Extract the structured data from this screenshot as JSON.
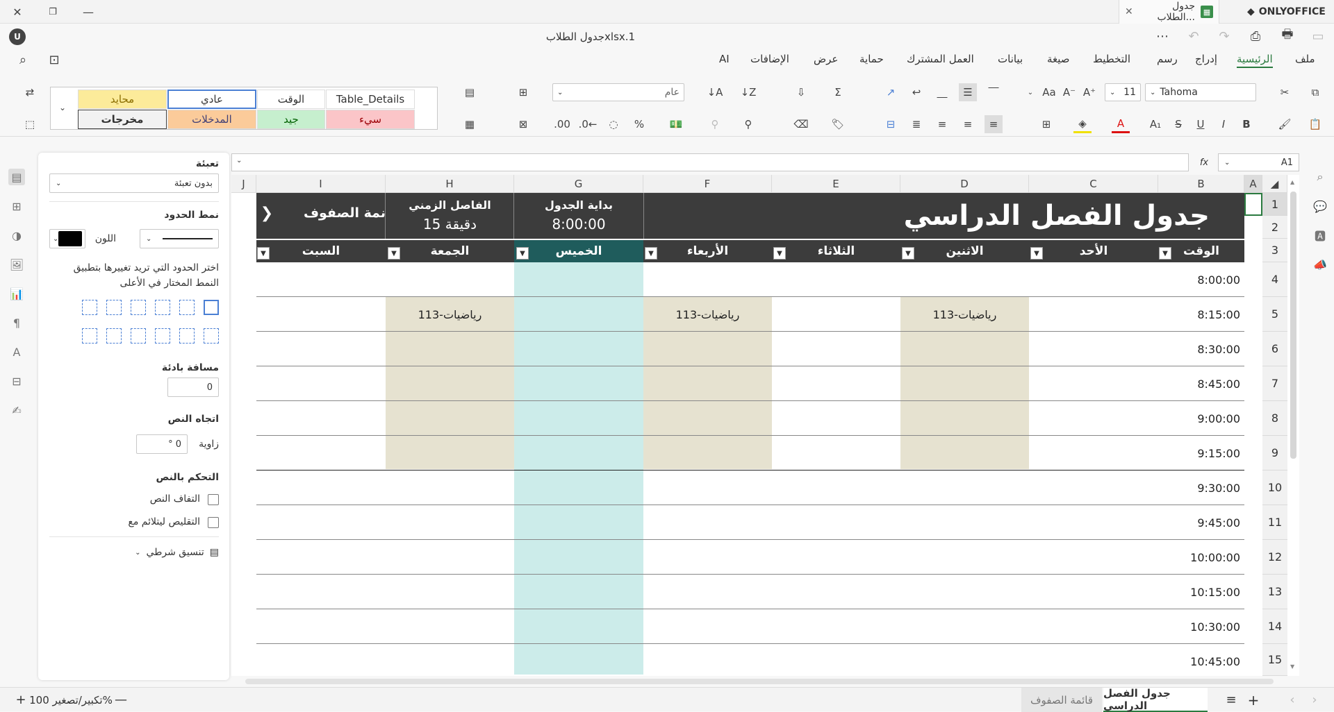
{
  "window": {
    "tab_title": "جدول الطلاب...",
    "brand": "ONLYOFFICE",
    "doc_title": "جدول الطلابxlsx.1",
    "user_initial": "U"
  },
  "menu": {
    "items": [
      "ملف",
      "الرئيسية",
      "إدراج",
      "رسم",
      "التخطيط",
      "صيغة",
      "بيانات",
      "العمل المشترك",
      "حماية",
      "عرض",
      "الإضافات",
      "AI"
    ],
    "active": "الرئيسية"
  },
  "toolbar": {
    "font_name": "Tahoma",
    "font_size": "11",
    "number_format": "عام",
    "styles": {
      "table_details": "Table_Details",
      "time": "الوقت",
      "normal": "عادي",
      "neutral": "محايد",
      "bad": "سيء",
      "good": "جيد",
      "input": "المدخلات",
      "output": "مخرجات"
    }
  },
  "formula_bar": {
    "cell_ref": "A1",
    "fx": "fx"
  },
  "panel": {
    "fill_label": "تعبئة",
    "fill_value": "بدون تعبئة",
    "border_style_label": "نمط الحدود",
    "color_label": "اللون",
    "border_hint": "اختر الحدود التي تريد تغييرها بتطبيق النمط المختار في الأعلى",
    "indent_label": "مسافة بادئة",
    "indent_value": "0",
    "text_direction_label": "اتجاه النص",
    "angle_label": "زاوية",
    "angle_value": "0 °",
    "text_control_label": "التحكم بالنص",
    "wrap_text": "التفاف النص",
    "shrink_to_fit": "التقليص ليتلائم مع",
    "conditional_format": "تنسيق شرطي"
  },
  "grid": {
    "columns": [
      "A",
      "B",
      "C",
      "D",
      "E",
      "F",
      "G",
      "H",
      "I",
      "J"
    ],
    "rows": [
      "1",
      "2",
      "3",
      "4",
      "5",
      "6",
      "7",
      "8",
      "9",
      "10",
      "11",
      "12",
      "13",
      "14",
      "15"
    ],
    "sheet_title": "جدول الفصل الدراسي",
    "start_label": "بداية الجدول",
    "start_value": "8:00:00",
    "interval_label": "الفاصل الزمني",
    "interval_value": "15 دقيقة",
    "rows_list_label": "نمة الصفوف",
    "rows_list_arrow": "❯",
    "day_headers": [
      "الوقت",
      "الأحد",
      "الاثنين",
      "الثلاثاء",
      "الأربعاء",
      "الخميس",
      "الجمعة",
      "السبت"
    ],
    "times": [
      "8:00:00",
      "8:15:00",
      "8:30:00",
      "8:45:00",
      "9:00:00",
      "9:15:00",
      "9:30:00",
      "9:45:00",
      "10:00:00",
      "10:15:00",
      "10:30:00",
      "10:45:00"
    ],
    "class_label": "رياضيات-113"
  },
  "status": {
    "zoom": "تكبير/تصغير 100%",
    "sheet_tabs": [
      "جدول الفصل الدراسي",
      "قائمة الصفوف"
    ]
  },
  "colors": {
    "accent": "#2a7a3f",
    "header_dark": "#3c3c3c",
    "thursday_header": "#1f5c5c",
    "thursday_fill": "#ccecea",
    "class_fill": "#e6e2d0"
  }
}
